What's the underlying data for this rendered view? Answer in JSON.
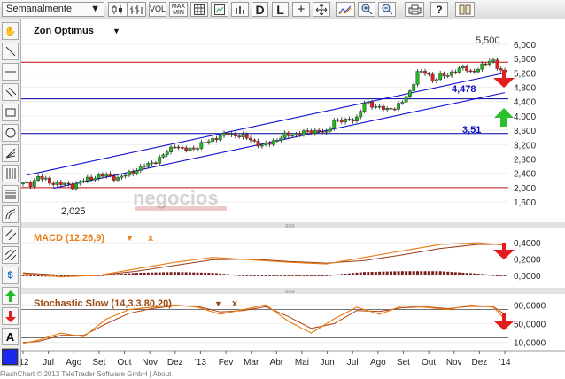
{
  "toolbar": {
    "period": "Semanalmente",
    "vol": "VOL",
    "min_max_top": "MAX",
    "min_max_bottom": "MIN",
    "d": "D",
    "l": "L"
  },
  "chart_title": "Zon Optimus",
  "indicators": {
    "macd": "MACD (12,26,9)",
    "stoch": "Stochastic Slow (14,3,3,80,20)",
    "close": "x"
  },
  "annotations": {
    "level_5500": "5,500",
    "level_4478": "4,478",
    "level_351": "3,51",
    "low_2025": "2,025"
  },
  "watermark": "negocios",
  "price_axis": [
    "6,000",
    "5,600",
    "5,200",
    "4,800",
    "4,400",
    "4,000",
    "3,600",
    "3,200",
    "2,800",
    "2,400",
    "2,000",
    "1,600"
  ],
  "macd_axis": [
    "0,4000",
    "0,2000",
    "0,0000"
  ],
  "stoch_axis": [
    "90,0000",
    "50,0000",
    "10,0000"
  ],
  "months": [
    "'12",
    "Jul",
    "Ago",
    "Set",
    "Out",
    "Nov",
    "Dez",
    "'13",
    "Fev",
    "Mar",
    "Abr",
    "Mai",
    "Jun",
    "Jul",
    "Ago",
    "Set",
    "Out",
    "Nov",
    "Dez",
    "'14"
  ],
  "footer": "FlashChart © 2013 TeleTrader Software GmbH | About",
  "colors": {
    "up": "#23b623",
    "down": "#e02020",
    "channel": "#1010d0",
    "hline_red": "#c01010",
    "hline_blue": "#0000a0",
    "macd_orange": "#e8801a",
    "macd_dark": "#9a3a1a",
    "hist": "#7a1d1d",
    "ann_blue": "#1010c0"
  },
  "chart_data": {
    "type": "candlestick",
    "title": "Zon Optimus",
    "period": "Semanalmente",
    "ylim": [
      1.6,
      6.0
    ],
    "price_path": [
      [
        0,
        2.1
      ],
      [
        2,
        2.1
      ],
      [
        4,
        2.3
      ],
      [
        7,
        2.15
      ],
      [
        10,
        2.1
      ],
      [
        13,
        2.05
      ],
      [
        16,
        2.2
      ],
      [
        19,
        2.3
      ],
      [
        22,
        2.35
      ],
      [
        25,
        2.25
      ],
      [
        28,
        2.4
      ],
      [
        31,
        2.55
      ],
      [
        34,
        2.7
      ],
      [
        36,
        2.8
      ],
      [
        38,
        3.0
      ],
      [
        40,
        3.2
      ],
      [
        42,
        3.05
      ],
      [
        45,
        3.1
      ],
      [
        48,
        3.25
      ],
      [
        51,
        3.4
      ],
      [
        54,
        3.5
      ],
      [
        57,
        3.45
      ],
      [
        60,
        3.35
      ],
      [
        63,
        3.15
      ],
      [
        66,
        3.3
      ],
      [
        69,
        3.45
      ],
      [
        72,
        3.5
      ],
      [
        75,
        3.55
      ],
      [
        78,
        3.6
      ],
      [
        80,
        3.5
      ],
      [
        82,
        3.9
      ],
      [
        85,
        3.85
      ],
      [
        88,
        3.95
      ],
      [
        90,
        4.35
      ],
      [
        92,
        4.3
      ],
      [
        94,
        4.25
      ],
      [
        96,
        4.15
      ],
      [
        98,
        4.25
      ],
      [
        100,
        4.4
      ],
      [
        102,
        4.65
      ],
      [
        104,
        5.25
      ],
      [
        106,
        5.2
      ],
      [
        108,
        5.0
      ],
      [
        110,
        5.15
      ],
      [
        112,
        5.1
      ],
      [
        114,
        5.3
      ],
      [
        116,
        5.35
      ],
      [
        118,
        5.2
      ],
      [
        120,
        5.35
      ],
      [
        122,
        5.45
      ],
      [
        124,
        5.55
      ],
      [
        126,
        5.25
      ],
      [
        127,
        5.2
      ]
    ],
    "horizontal_levels": [
      5.5,
      4.478,
      3.51,
      2.0
    ],
    "low_label_value": 2.025,
    "channel_upper": [
      [
        1,
        2.35
      ],
      [
        127,
        5.2
      ]
    ],
    "channel_lower": [
      [
        8,
        1.98
      ],
      [
        127,
        4.65
      ]
    ],
    "macd_ylim": [
      -0.1,
      0.5
    ],
    "macd_line": [
      [
        0,
        0.02
      ],
      [
        10,
        -0.02
      ],
      [
        20,
        0.0
      ],
      [
        30,
        0.08
      ],
      [
        40,
        0.16
      ],
      [
        50,
        0.22
      ],
      [
        60,
        0.19
      ],
      [
        70,
        0.16
      ],
      [
        80,
        0.14
      ],
      [
        90,
        0.22
      ],
      [
        100,
        0.3
      ],
      [
        110,
        0.38
      ],
      [
        120,
        0.4
      ],
      [
        127,
        0.37
      ]
    ],
    "macd_signal": [
      [
        0,
        0.03
      ],
      [
        10,
        0.0
      ],
      [
        20,
        0.0
      ],
      [
        30,
        0.05
      ],
      [
        40,
        0.12
      ],
      [
        50,
        0.19
      ],
      [
        60,
        0.2
      ],
      [
        70,
        0.17
      ],
      [
        80,
        0.15
      ],
      [
        90,
        0.18
      ],
      [
        100,
        0.25
      ],
      [
        110,
        0.33
      ],
      [
        120,
        0.38
      ],
      [
        127,
        0.38
      ]
    ],
    "macd_hist": [
      [
        0,
        -0.01
      ],
      [
        10,
        -0.02
      ],
      [
        20,
        0.0
      ],
      [
        30,
        0.03
      ],
      [
        40,
        0.04
      ],
      [
        50,
        0.03
      ],
      [
        60,
        -0.01
      ],
      [
        70,
        -0.01
      ],
      [
        80,
        0.0
      ],
      [
        90,
        0.04
      ],
      [
        100,
        0.05
      ],
      [
        110,
        0.05
      ],
      [
        120,
        0.02
      ],
      [
        127,
        -0.01
      ]
    ],
    "stoch_ylim": [
      0,
      100
    ],
    "stoch_k": [
      [
        0,
        8
      ],
      [
        4,
        15
      ],
      [
        10,
        30
      ],
      [
        16,
        22
      ],
      [
        22,
        60
      ],
      [
        28,
        80
      ],
      [
        34,
        85
      ],
      [
        40,
        90
      ],
      [
        46,
        85
      ],
      [
        52,
        70
      ],
      [
        58,
        80
      ],
      [
        64,
        90
      ],
      [
        70,
        55
      ],
      [
        76,
        30
      ],
      [
        82,
        60
      ],
      [
        88,
        85
      ],
      [
        94,
        70
      ],
      [
        100,
        88
      ],
      [
        106,
        85
      ],
      [
        112,
        80
      ],
      [
        118,
        90
      ],
      [
        124,
        85
      ],
      [
        127,
        60
      ]
    ],
    "stoch_d": [
      [
        0,
        10
      ],
      [
        4,
        12
      ],
      [
        10,
        25
      ],
      [
        16,
        25
      ],
      [
        22,
        50
      ],
      [
        28,
        72
      ],
      [
        34,
        82
      ],
      [
        40,
        88
      ],
      [
        46,
        87
      ],
      [
        52,
        75
      ],
      [
        58,
        78
      ],
      [
        64,
        86
      ],
      [
        70,
        65
      ],
      [
        76,
        40
      ],
      [
        82,
        50
      ],
      [
        88,
        78
      ],
      [
        94,
        76
      ],
      [
        100,
        84
      ],
      [
        106,
        86
      ],
      [
        112,
        82
      ],
      [
        118,
        87
      ],
      [
        124,
        86
      ],
      [
        127,
        70
      ]
    ],
    "stoch_levels": [
      80,
      20
    ]
  }
}
